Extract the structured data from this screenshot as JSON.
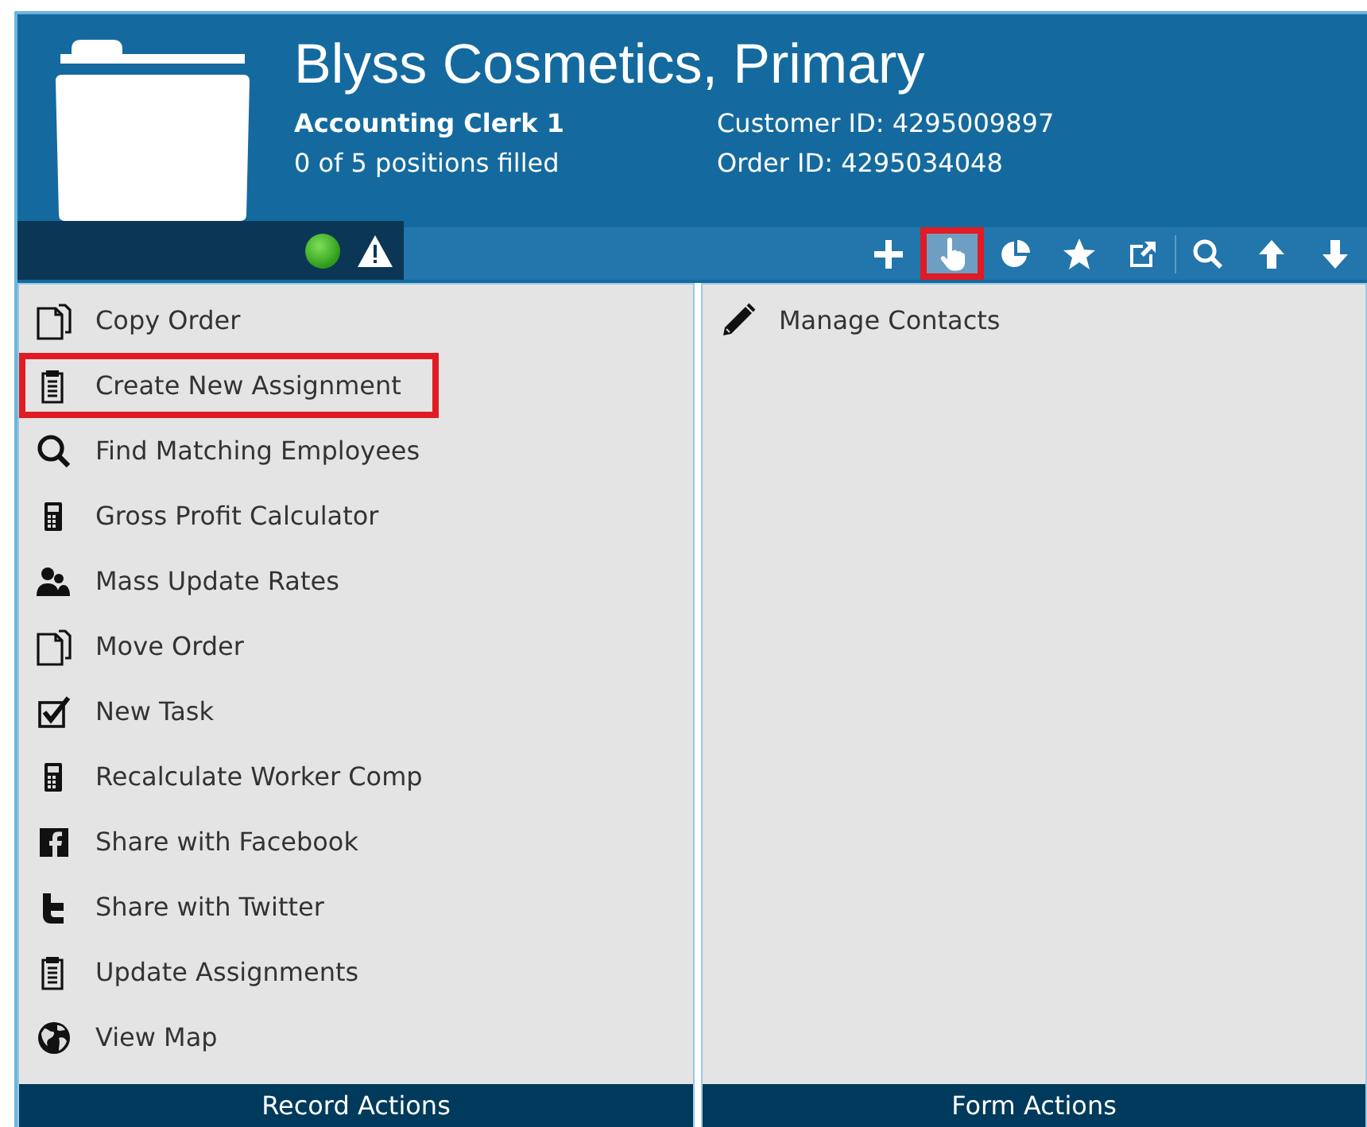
{
  "header": {
    "title": "Blyss Cosmetics, Primary",
    "position": "Accounting Clerk 1",
    "positions_filled": "0 of 5 positions filled",
    "customer_id": "Customer ID: 4295009897",
    "order_id": "Order ID: 4295034048"
  },
  "toolbar": [
    {
      "kind": "add",
      "highlighted": false
    },
    {
      "kind": "hand",
      "highlighted": true
    },
    {
      "kind": "pie",
      "highlighted": false
    },
    {
      "kind": "star",
      "highlighted": false
    },
    {
      "kind": "external",
      "highlighted": false
    },
    {
      "kind": "search",
      "highlighted": false
    },
    {
      "kind": "up",
      "highlighted": false
    },
    {
      "kind": "down",
      "highlighted": false
    }
  ],
  "record_actions": {
    "title": "Record Actions",
    "items": [
      {
        "label": "Copy Order",
        "kind": "copy",
        "highlighted": false
      },
      {
        "label": "Create New Assignment",
        "kind": "notepad",
        "highlighted": true
      },
      {
        "label": "Find Matching Employees",
        "kind": "search",
        "highlighted": false
      },
      {
        "label": "Gross Profit Calculator",
        "kind": "calculator",
        "highlighted": false
      },
      {
        "label": "Mass Update Rates",
        "kind": "people",
        "highlighted": false
      },
      {
        "label": "Move Order",
        "kind": "copy",
        "highlighted": false
      },
      {
        "label": "New Task",
        "kind": "check",
        "highlighted": false
      },
      {
        "label": "Recalculate Worker Comp",
        "kind": "calculator",
        "highlighted": false
      },
      {
        "label": "Share with Facebook",
        "kind": "facebook",
        "highlighted": false
      },
      {
        "label": "Share with Twitter",
        "kind": "twitter",
        "highlighted": false
      },
      {
        "label": "Update Assignments",
        "kind": "notepad",
        "highlighted": false
      },
      {
        "label": "View Map",
        "kind": "globe",
        "highlighted": false
      }
    ]
  },
  "form_actions": {
    "title": "Form Actions",
    "items": [
      {
        "label": "Manage Contacts",
        "kind": "pencil",
        "highlighted": false
      }
    ]
  }
}
